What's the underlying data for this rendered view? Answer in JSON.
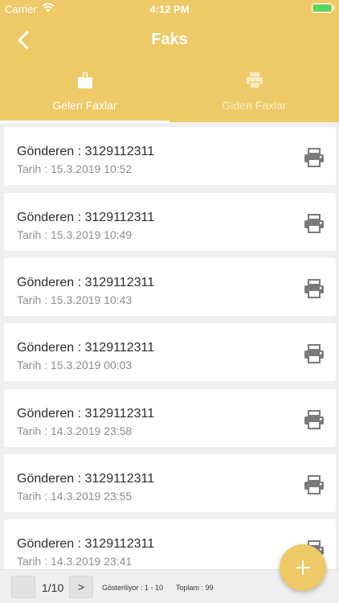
{
  "status_bar": {
    "carrier": "Carrier",
    "time": "4:12 PM",
    "battery_level": 1.0
  },
  "nav": {
    "title": "Faks",
    "back_icon": "chevron-left-icon"
  },
  "tabs": [
    {
      "label": "Gelen Faxlar",
      "icon": "inbox-fax-icon",
      "active": true
    },
    {
      "label": "Giden Faxlar",
      "icon": "printer-icon",
      "active": false
    }
  ],
  "faxes": [
    {
      "sender": "Gönderen : 3129112311",
      "date": "Tarih : 15.3.2019 10:52"
    },
    {
      "sender": "Gönderen : 3129112311",
      "date": "Tarih : 15.3.2019 10:49"
    },
    {
      "sender": "Gönderen : 3129112311",
      "date": "Tarih : 15.3.2019 10:43"
    },
    {
      "sender": "Gönderen : 3129112311",
      "date": "Tarih : 15.3.2019 00:03"
    },
    {
      "sender": "Gönderen : 3129112311",
      "date": "Tarih : 14.3.2019 23:58"
    },
    {
      "sender": "Gönderen : 3129112311",
      "date": "Tarih : 14.3.2019 23:55"
    },
    {
      "sender": "Gönderen : 3129112311",
      "date": "Tarih : 14.3.2019 23:41"
    }
  ],
  "pagination": {
    "prev_label": "",
    "page_indicator": "1/10",
    "next_label": ">",
    "showing": "Gösteriliyor : 1 - 10",
    "total": "Toplam : 99"
  },
  "fab": {
    "icon": "plus-icon"
  },
  "colors": {
    "accent": "#edc967",
    "background": "#efefef",
    "battery": "#4cd964"
  }
}
